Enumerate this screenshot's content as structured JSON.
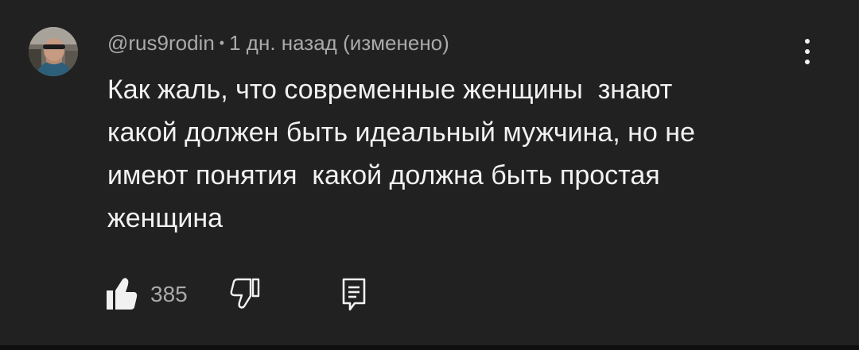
{
  "comment": {
    "author": "@rus9rodin",
    "separator": "•",
    "time": "1 дн. назад (изменено)",
    "text": "Как жаль, что современные женщины  знают\nкакой должен быть идеальный мужчина, но не\nимеют понятия  какой должна быть простая\nженщина",
    "like_count": "385"
  },
  "icons": {
    "avatar": "avatar-photo",
    "menu": "more-vertical-icon",
    "like": "thumbs-up-icon",
    "dislike": "thumbs-down-icon",
    "reply": "reply-comment-icon"
  },
  "colors": {
    "background": "#212121",
    "text_primary": "#f1f1f1",
    "text_secondary": "#aaaaaa"
  }
}
